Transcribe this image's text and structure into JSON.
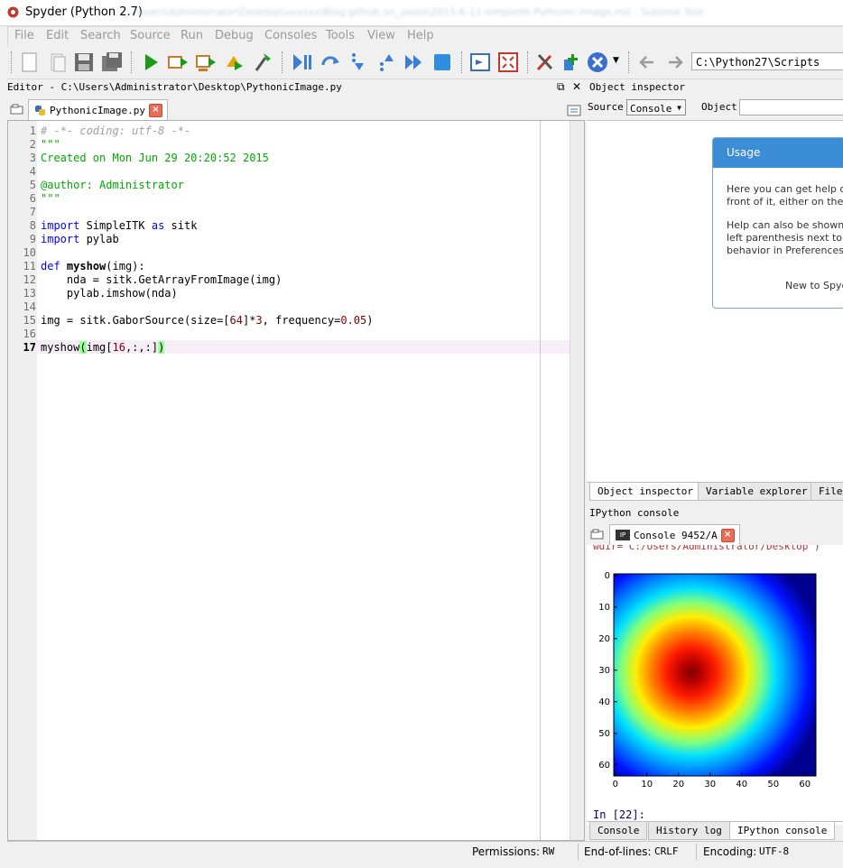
{
  "window": {
    "title": "Spyder (Python 2.7)",
    "background_title": "\\users\\Administrator\\Desktop\\uxxxxx\\Blog.github.io\\_posts\\2015-6-11-simpleitk-Pythonic-Image.md - Sublime Text"
  },
  "menu": [
    "File",
    "Edit",
    "Search",
    "Source",
    "Run",
    "Debug",
    "Consoles",
    "Tools",
    "View",
    "Help"
  ],
  "toolbar": {
    "icons": [
      "new-file-icon",
      "open-file-icon",
      "save-icon",
      "save-all-icon",
      "run-icon",
      "run-cell-icon",
      "run-cell-advance-icon",
      "run-selection-icon",
      "configure-run-icon",
      "debug-icon",
      "step-icon",
      "step-into-icon",
      "step-return-icon",
      "continue-icon",
      "stop-icon",
      "maximize-pane-icon",
      "fullscreen-icon",
      "preferences-icon",
      "pythonpath-icon",
      "python-icon",
      "back-icon",
      "forward-icon"
    ],
    "path": "C:\\Python27\\Scripts"
  },
  "editor": {
    "pane_title": "Editor - C:\\Users\\Administrator\\Desktop\\PythonicImage.py",
    "tab_label": "PythonicImage.py",
    "current_line": 17
  },
  "object_inspector": {
    "pane_title": "Object inspector",
    "source_label": "Source",
    "source_value": "Console",
    "object_label": "Object",
    "usage_title": "Usage",
    "usage_lines": [
      "Here you can get help o",
      "front of it, either on the",
      "Help can also be shown",
      "left parenthesis next to",
      "behavior in Preferences >",
      "New to Spyd"
    ],
    "tabs": [
      "Object inspector",
      "Variable explorer",
      "File"
    ]
  },
  "console": {
    "pane_title": "IPython console",
    "tab_label": "Console 9452/A",
    "partial_output": "wdir='C:/Users/Administrator/Desktop')",
    "prompt": "In [22]:",
    "tabs": [
      "Console",
      "History log",
      "IPython console"
    ]
  },
  "plot": {
    "yticks": [
      "0",
      "10",
      "20",
      "30",
      "40",
      "50",
      "60"
    ],
    "xticks": [
      "0",
      "10",
      "20",
      "30",
      "40",
      "50",
      "60"
    ]
  },
  "status": {
    "permissions_label": "Permissions:",
    "permissions_value": "RW",
    "eol_label": "End-of-lines:",
    "eol_value": "CRLF",
    "encoding_label": "Encoding:",
    "encoding_value": "UTF-8"
  },
  "colors": {
    "usage_header": "#3b8ed6",
    "string": "#00aa00",
    "keyword": "#0000ff",
    "number": "#800000"
  }
}
